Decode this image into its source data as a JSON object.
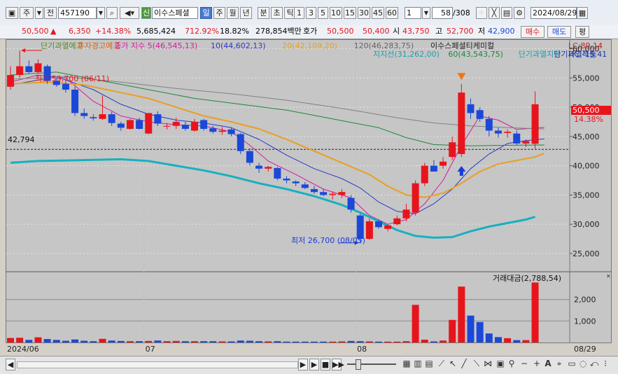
{
  "toolbar1": {
    "type_label": "주",
    "jeon_label": "전",
    "code_value": "457190",
    "stock_name": "이수스페셜",
    "new_badge": "신",
    "period_buttons": [
      "일",
      "주",
      "월",
      "년",
      "분",
      "초",
      "틱"
    ],
    "active_period": "일",
    "interval_buttons": [
      "1",
      "3",
      "5",
      "10",
      "15",
      "30",
      "45",
      "60"
    ],
    "count_value": "1",
    "page_indicator": "58",
    "page_total": "/308",
    "date_value": "2024/08/29"
  },
  "toolbar2": {
    "price": "50,500",
    "change_arrow": "▲",
    "change": "6,350",
    "change_pct": "+14.38%",
    "volume": "5,685,424",
    "vol_ratio": "712.92%",
    "turnover": "18.82%",
    "amount": "278,854백만",
    "hoga_label": "호가",
    "ask": "50,500",
    "bid": "50,400",
    "open_label": "시",
    "open": "43,750",
    "high_label": "고",
    "high": "52,700",
    "low_label": "저",
    "low": "42,900",
    "buy_label": "매수",
    "sell_label": "매도",
    "pyeong_label": "평"
  },
  "legend": {
    "row1": [
      {
        "text": "단기과열예고",
        "color": "#5a8a2a"
      },
      {
        "text": "투자경고예고",
        "color": "#d46a1a"
      },
      {
        "text": "종가 지수 5(46,545,13)",
        "color": "#d81aa0"
      },
      {
        "text": "10(44,602,13)",
        "color": "#2a3ac8"
      },
      {
        "text": "20(42,109,20)",
        "color": "#e8a020"
      },
      {
        "text": "120(46,283,75)",
        "color": "#666666"
      },
      {
        "text": "이수스페셜티케미컬",
        "color": "#222222"
      }
    ],
    "row2": [
      {
        "text": "지지선(31,262,00)",
        "color": "#1aa0b0"
      },
      {
        "text": "60(43,543,75)",
        "color": "#1a8a3a"
      },
      {
        "text": "단기과열지정",
        "color": "#1aa0b0"
      },
      {
        "text": "단기과열적출",
        "color": "#1a3ab0"
      }
    ],
    "lc": "LC:89.14",
    "hc": "HC:-15.41"
  },
  "annotations": {
    "high_marker": "최고 59,700 (06/11)",
    "low_marker": "최저 26,700 (08/05)",
    "ref_line_label": "42,794",
    "price_tag": "50,500",
    "pct_tag": "14.38%"
  },
  "volume_panel": {
    "title": "거래대금(2,788,54)"
  },
  "colors": {
    "up": "#e8141c",
    "down": "#1a48d8",
    "ma5": "#d81aa0",
    "ma10": "#2a3ac8",
    "ma20": "#e8a020",
    "ma60": "#1a8a3a",
    "ma120": "#808080",
    "support": "#18b0c0"
  },
  "chart_data": {
    "type": "candlestick",
    "ylim": [
      22000,
      61500
    ],
    "yticks": [
      25000,
      30000,
      35000,
      40000,
      45000,
      50000,
      55000,
      60000
    ],
    "ytick_labels": [
      "25,000",
      "30,000",
      "35,000",
      "40,000",
      "45,000",
      "50,000",
      "55,000",
      "60,000"
    ],
    "volume_ylim": [
      0,
      2900
    ],
    "volume_yticks": [
      1000,
      2000
    ],
    "volume_ytick_labels": [
      "1,000",
      "2,000"
    ],
    "x_labels": [
      {
        "label": "2024/06",
        "index": 0
      },
      {
        "label": "07",
        "index": 15
      },
      {
        "label": "08",
        "index": 38
      },
      {
        "label": "08/29",
        "index": 58
      }
    ],
    "candles": [
      {
        "o": 53500,
        "h": 57000,
        "l": 53000,
        "c": 55500,
        "v": 210
      },
      {
        "o": 55500,
        "h": 59700,
        "l": 55000,
        "c": 57000,
        "v": 220
      },
      {
        "o": 57000,
        "h": 58000,
        "l": 55800,
        "c": 56000,
        "v": 120
      },
      {
        "o": 56000,
        "h": 58200,
        "l": 55800,
        "c": 57500,
        "v": 240
      },
      {
        "o": 57000,
        "h": 57300,
        "l": 54000,
        "c": 54500,
        "v": 160
      },
      {
        "o": 54500,
        "h": 55000,
        "l": 53500,
        "c": 53800,
        "v": 120
      },
      {
        "o": 54000,
        "h": 54500,
        "l": 52500,
        "c": 53000,
        "v": 80
      },
      {
        "o": 53000,
        "h": 53500,
        "l": 48500,
        "c": 49000,
        "v": 140
      },
      {
        "o": 49000,
        "h": 49800,
        "l": 48000,
        "c": 48500,
        "v": 80
      },
      {
        "o": 48300,
        "h": 48800,
        "l": 47700,
        "c": 48100,
        "v": 60
      },
      {
        "o": 48000,
        "h": 52000,
        "l": 47800,
        "c": 48800,
        "v": 170
      },
      {
        "o": 48800,
        "h": 49200,
        "l": 46800,
        "c": 47300,
        "v": 90
      },
      {
        "o": 47200,
        "h": 47500,
        "l": 46000,
        "c": 46500,
        "v": 70
      },
      {
        "o": 46300,
        "h": 48000,
        "l": 46200,
        "c": 47800,
        "v": 60
      },
      {
        "o": 47800,
        "h": 48200,
        "l": 46200,
        "c": 46300,
        "v": 60
      },
      {
        "o": 45500,
        "h": 47800,
        "l": 45400,
        "c": 49000,
        "v": 70
      },
      {
        "o": 48800,
        "h": 49300,
        "l": 46800,
        "c": 47200,
        "v": 90
      },
      {
        "o": 46800,
        "h": 47300,
        "l": 46200,
        "c": 46800,
        "v": 60
      },
      {
        "o": 46800,
        "h": 48200,
        "l": 46300,
        "c": 47500,
        "v": 70
      },
      {
        "o": 47000,
        "h": 47500,
        "l": 46000,
        "c": 46300,
        "v": 60
      },
      {
        "o": 46000,
        "h": 48000,
        "l": 45800,
        "c": 47500,
        "v": 60
      },
      {
        "o": 47800,
        "h": 48000,
        "l": 46000,
        "c": 46300,
        "v": 60
      },
      {
        "o": 46400,
        "h": 46800,
        "l": 45500,
        "c": 45800,
        "v": 60
      },
      {
        "o": 45800,
        "h": 46600,
        "l": 45300,
        "c": 46000,
        "v": 50
      },
      {
        "o": 46200,
        "h": 46500,
        "l": 45000,
        "c": 45400,
        "v": 50
      },
      {
        "o": 45400,
        "h": 45600,
        "l": 42000,
        "c": 42500,
        "v": 90
      },
      {
        "o": 42500,
        "h": 43000,
        "l": 40000,
        "c": 40500,
        "v": 80
      },
      {
        "o": 40000,
        "h": 40500,
        "l": 38800,
        "c": 39500,
        "v": 60
      },
      {
        "o": 39500,
        "h": 40000,
        "l": 39000,
        "c": 39800,
        "v": 50
      },
      {
        "o": 39600,
        "h": 39800,
        "l": 37500,
        "c": 37800,
        "v": 60
      },
      {
        "o": 37800,
        "h": 38200,
        "l": 37000,
        "c": 37500,
        "v": 40
      },
      {
        "o": 37300,
        "h": 37500,
        "l": 36500,
        "c": 37000,
        "v": 40
      },
      {
        "o": 36800,
        "h": 37200,
        "l": 36000,
        "c": 36200,
        "v": 40
      },
      {
        "o": 36000,
        "h": 36500,
        "l": 35200,
        "c": 35500,
        "v": 40
      },
      {
        "o": 35500,
        "h": 36000,
        "l": 34800,
        "c": 35000,
        "v": 40
      },
      {
        "o": 35000,
        "h": 35600,
        "l": 34200,
        "c": 35200,
        "v": 40
      },
      {
        "o": 35000,
        "h": 36000,
        "l": 34500,
        "c": 35500,
        "v": 50
      },
      {
        "o": 34500,
        "h": 35000,
        "l": 32000,
        "c": 32500,
        "v": 70
      },
      {
        "o": 31500,
        "h": 31800,
        "l": 26700,
        "c": 27500,
        "v": 60
      },
      {
        "o": 27500,
        "h": 31000,
        "l": 27300,
        "c": 30500,
        "v": 50
      },
      {
        "o": 30500,
        "h": 30800,
        "l": 29200,
        "c": 29500,
        "v": 40
      },
      {
        "o": 29200,
        "h": 30000,
        "l": 28800,
        "c": 29800,
        "v": 40
      },
      {
        "o": 30000,
        "h": 31500,
        "l": 29800,
        "c": 31000,
        "v": 40
      },
      {
        "o": 31000,
        "h": 33500,
        "l": 30500,
        "c": 32500,
        "v": 60
      },
      {
        "o": 32000,
        "h": 37500,
        "l": 31500,
        "c": 37000,
        "v": 1750
      },
      {
        "o": 37000,
        "h": 40500,
        "l": 36500,
        "c": 40000,
        "v": 130
      },
      {
        "o": 40000,
        "h": 41000,
        "l": 39000,
        "c": 39000,
        "v": 50
      },
      {
        "o": 40000,
        "h": 41500,
        "l": 39500,
        "c": 40700,
        "v": 90
      },
      {
        "o": 41500,
        "h": 45000,
        "l": 41000,
        "c": 44000,
        "v": 1050
      },
      {
        "o": 42000,
        "h": 54000,
        "l": 41500,
        "c": 52500,
        "v": 2600
      },
      {
        "o": 50500,
        "h": 51500,
        "l": 48000,
        "c": 49000,
        "v": 1250
      },
      {
        "o": 49500,
        "h": 50000,
        "l": 47500,
        "c": 48000,
        "v": 950
      },
      {
        "o": 48000,
        "h": 48500,
        "l": 45000,
        "c": 46000,
        "v": 420
      },
      {
        "o": 46000,
        "h": 46500,
        "l": 44800,
        "c": 45500,
        "v": 250
      },
      {
        "o": 45600,
        "h": 46200,
        "l": 44800,
        "c": 45800,
        "v": 200
      },
      {
        "o": 45500,
        "h": 46000,
        "l": 43500,
        "c": 43800,
        "v": 110
      },
      {
        "o": 43800,
        "h": 44500,
        "l": 43200,
        "c": 44200,
        "v": 110
      },
      {
        "o": 43750,
        "h": 52700,
        "l": 42900,
        "c": 50500,
        "v": 2788.54
      }
    ],
    "lines": [
      {
        "name": "5",
        "color": "#d81aa0",
        "width": 1,
        "points": [
          [
            0,
            54300
          ],
          [
            3,
            55500
          ],
          [
            6,
            55000
          ],
          [
            9,
            51000
          ],
          [
            12,
            48500
          ],
          [
            15,
            47500
          ],
          [
            18,
            47000
          ],
          [
            21,
            46800
          ],
          [
            24,
            45800
          ],
          [
            26,
            43500
          ],
          [
            28,
            40800
          ],
          [
            31,
            38500
          ],
          [
            34,
            36000
          ],
          [
            37,
            34500
          ],
          [
            39,
            31500
          ],
          [
            41,
            30000
          ],
          [
            43,
            30800
          ],
          [
            45,
            33500
          ],
          [
            47,
            37500
          ],
          [
            49,
            43500
          ],
          [
            51,
            48500
          ],
          [
            53,
            47800
          ],
          [
            55,
            46200
          ],
          [
            58,
            46545
          ]
        ]
      },
      {
        "name": "10",
        "color": "#2a3ac8",
        "width": 1,
        "points": [
          [
            0,
            53800
          ],
          [
            5,
            55200
          ],
          [
            9,
            53000
          ],
          [
            12,
            50500
          ],
          [
            15,
            48800
          ],
          [
            18,
            47800
          ],
          [
            21,
            47300
          ],
          [
            24,
            46500
          ],
          [
            27,
            44500
          ],
          [
            30,
            41800
          ],
          [
            33,
            39500
          ],
          [
            36,
            37800
          ],
          [
            38,
            36200
          ],
          [
            40,
            33800
          ],
          [
            42,
            32200
          ],
          [
            44,
            31800
          ],
          [
            46,
            33500
          ],
          [
            48,
            36000
          ],
          [
            50,
            39500
          ],
          [
            52,
            42000
          ],
          [
            54,
            43800
          ],
          [
            56,
            44300
          ],
          [
            58,
            44602
          ]
        ]
      },
      {
        "name": "20",
        "color": "#e8a020",
        "width": 2,
        "points": [
          [
            0,
            54000
          ],
          [
            4,
            54300
          ],
          [
            8,
            53800
          ],
          [
            12,
            52500
          ],
          [
            15,
            51500
          ],
          [
            18,
            50000
          ],
          [
            21,
            48500
          ],
          [
            24,
            47500
          ],
          [
            27,
            46300
          ],
          [
            30,
            44500
          ],
          [
            33,
            42500
          ],
          [
            36,
            40500
          ],
          [
            39,
            38500
          ],
          [
            41,
            36500
          ],
          [
            43,
            35000
          ],
          [
            45,
            34600
          ],
          [
            47,
            35300
          ],
          [
            49,
            37000
          ],
          [
            51,
            39000
          ],
          [
            53,
            40300
          ],
          [
            55,
            40900
          ],
          [
            57,
            41500
          ],
          [
            58,
            42109
          ]
        ]
      },
      {
        "name": "60",
        "color": "#1a8a3a",
        "width": 1,
        "points": [
          [
            0,
            55500
          ],
          [
            5,
            56000
          ],
          [
            10,
            54500
          ],
          [
            15,
            53000
          ],
          [
            20,
            51500
          ],
          [
            25,
            50500
          ],
          [
            30,
            49500
          ],
          [
            35,
            48000
          ],
          [
            40,
            46500
          ],
          [
            43,
            44800
          ],
          [
            46,
            43600
          ],
          [
            50,
            43400
          ],
          [
            54,
            43500
          ],
          [
            58,
            43543
          ]
        ]
      },
      {
        "name": "120",
        "color": "#808080",
        "width": 1,
        "points": [
          [
            0,
            54800
          ],
          [
            6,
            55200
          ],
          [
            12,
            54300
          ],
          [
            18,
            53200
          ],
          [
            24,
            52300
          ],
          [
            30,
            51200
          ],
          [
            36,
            49800
          ],
          [
            42,
            48200
          ],
          [
            46,
            47300
          ],
          [
            50,
            46800
          ],
          [
            54,
            46500
          ],
          [
            58,
            46283
          ]
        ]
      },
      {
        "name": "지지선",
        "color": "#18b0c0",
        "width": 3,
        "points": [
          [
            0,
            40500
          ],
          [
            3,
            40800
          ],
          [
            6,
            40900
          ],
          [
            9,
            41000
          ],
          [
            12,
            41100
          ],
          [
            15,
            40800
          ],
          [
            18,
            40000
          ],
          [
            21,
            39200
          ],
          [
            24,
            38200
          ],
          [
            27,
            37000
          ],
          [
            30,
            36000
          ],
          [
            33,
            34800
          ],
          [
            36,
            33300
          ],
          [
            38,
            32000
          ],
          [
            40,
            30500
          ],
          [
            42,
            29000
          ],
          [
            44,
            28000
          ],
          [
            46,
            27700
          ],
          [
            48,
            27800
          ],
          [
            50,
            28800
          ],
          [
            52,
            29600
          ],
          [
            54,
            30200
          ],
          [
            56,
            30800
          ],
          [
            57,
            31262
          ]
        ]
      }
    ],
    "markers": [
      {
        "type": "down-triangle",
        "index": 49,
        "value": 55000,
        "color": "#ee7711"
      },
      {
        "type": "up-arrow",
        "index": 49,
        "value": 39000,
        "color": "#1a3ad8"
      }
    ]
  }
}
